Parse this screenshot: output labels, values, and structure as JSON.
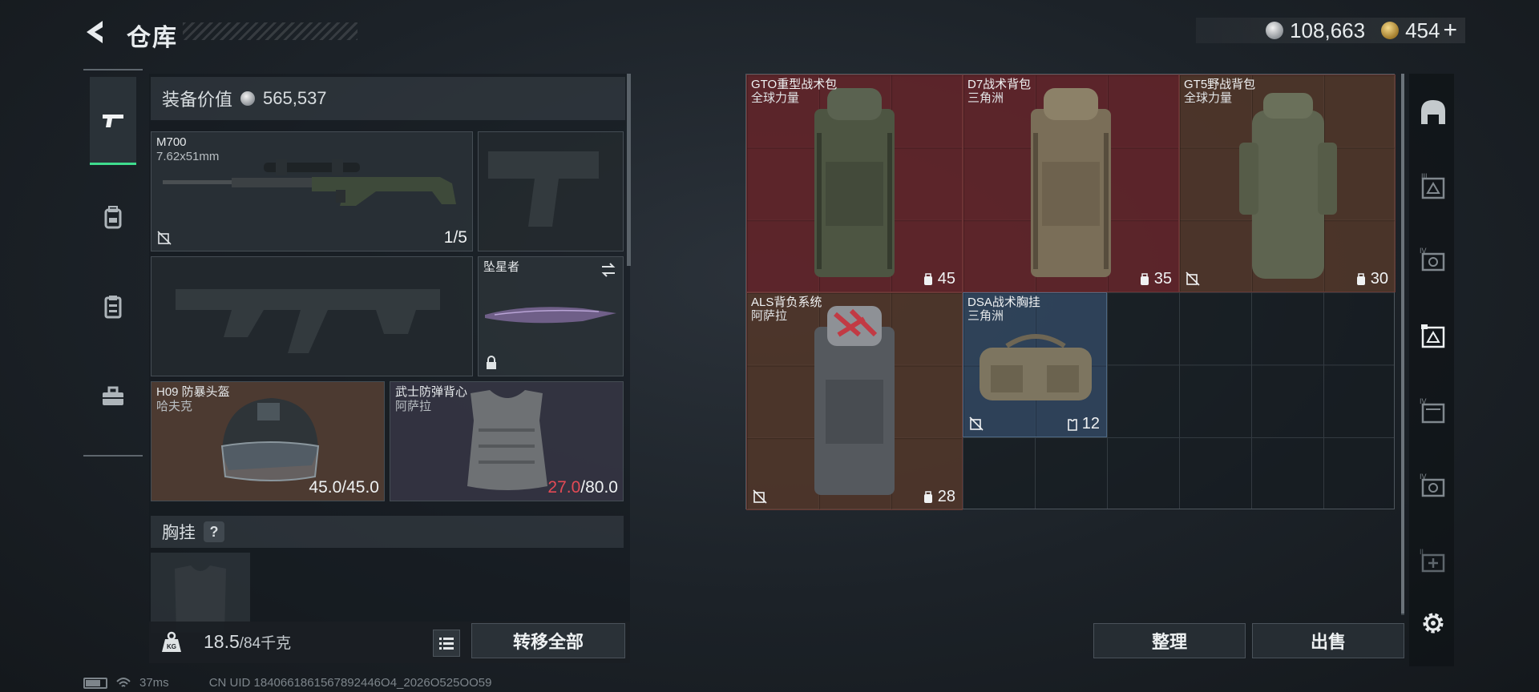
{
  "header": {
    "title": "仓库"
  },
  "currency": {
    "silver": "108,663",
    "gold": "454",
    "plus": "+"
  },
  "equipment": {
    "value_label": "装备价值",
    "value": "565,537",
    "primary": {
      "name": "M700",
      "caliber": "7.62x51mm",
      "ammo": "1/5"
    },
    "melee": {
      "name": "坠星者"
    },
    "helmet": {
      "name": "H09 防暴头盔",
      "sub": "哈夫克",
      "durability": "45.0/45.0"
    },
    "armor": {
      "name": "武士防弹背心",
      "sub": "阿萨拉",
      "durability_current": "27.0",
      "durability_max": "/80.0"
    },
    "chest_label": "胸挂",
    "chest_help": "?"
  },
  "weight": {
    "current": "18.5",
    "max": "/84千克",
    "transfer_all": "转移全部"
  },
  "status": {
    "ping": "37ms",
    "uid": "CN UID 1840661861567892446O4_2026O525OO59"
  },
  "storage": {
    "items": [
      {
        "name": "GTO重型战术包",
        "sub": "全球力量",
        "capacity": "45"
      },
      {
        "name": "D7战术背包",
        "sub": "三角洲",
        "capacity": "35"
      },
      {
        "name": "GT5野战背包",
        "sub": "全球力量",
        "capacity": "30"
      },
      {
        "name": "ALS背负系统",
        "sub": "阿萨拉",
        "capacity": "28"
      },
      {
        "name": "DSA战术胸挂",
        "sub": "三角洲",
        "capacity": "12"
      }
    ],
    "sort_label": "整理",
    "sell_label": "出售"
  },
  "colors": {
    "accent_green": "#3fdc8e",
    "red_bg": "#6e262c",
    "blue_bg": "#324862",
    "durability_low": "#e34a55"
  },
  "icons": {
    "left_nav": [
      "pistol-icon",
      "backpack-icon",
      "clipboard-icon",
      "toolbox-icon"
    ],
    "right_nav": [
      "helmet-icon",
      "storage-3-icon",
      "storage-4-icon",
      "storage-5-icon",
      "storage-6-icon",
      "storage-7-icon",
      "storage-8-icon",
      "settings-icon"
    ]
  }
}
